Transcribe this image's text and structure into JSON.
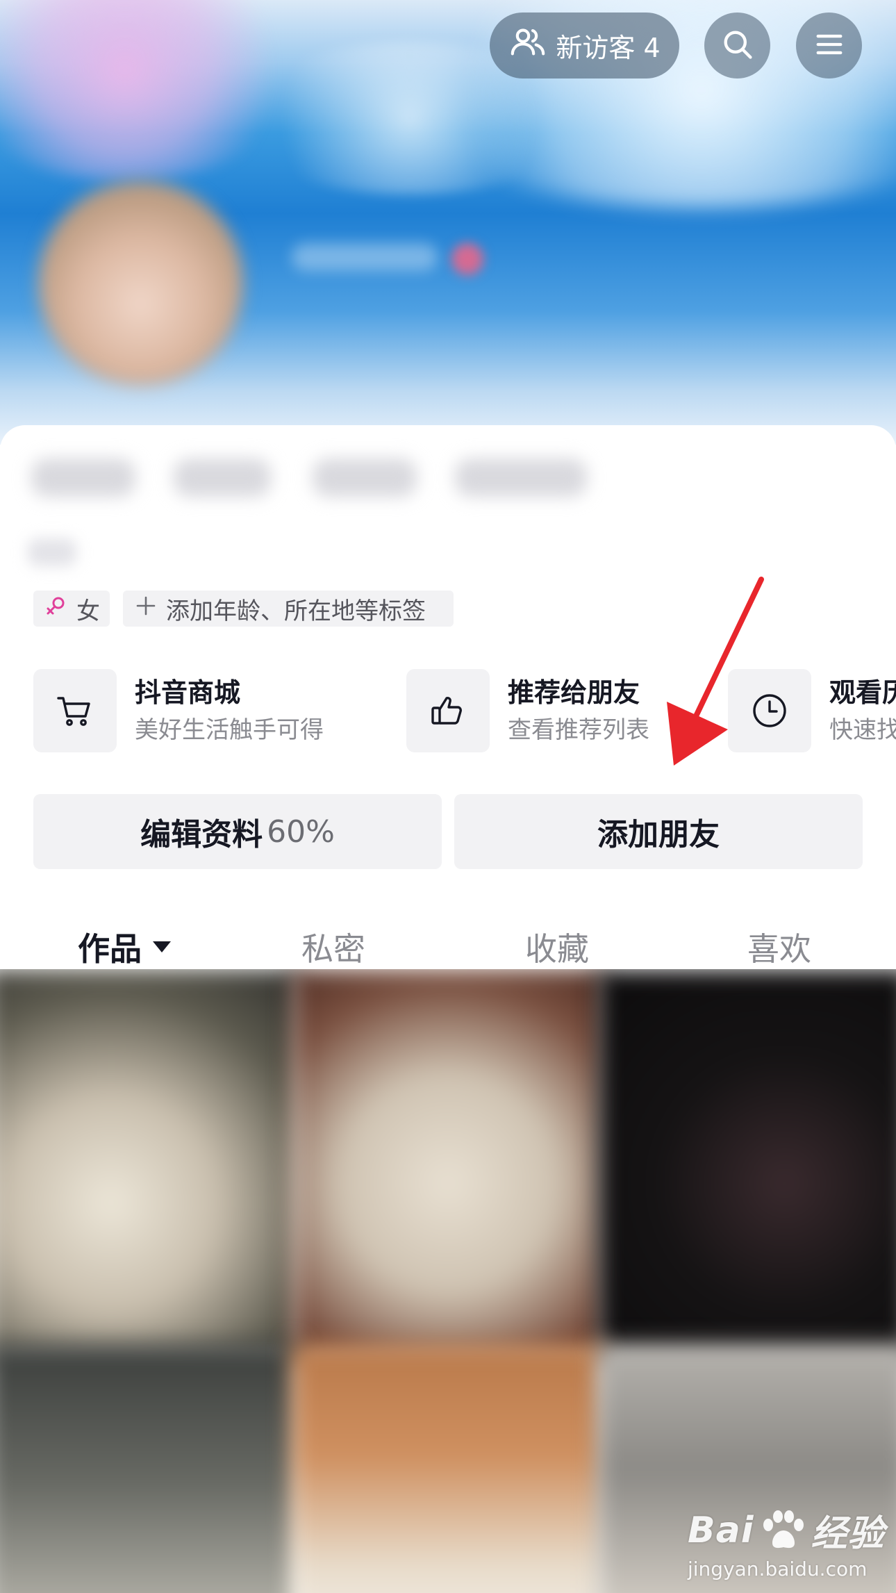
{
  "header": {
    "visitor_label": "新访客 4",
    "icons": [
      "visitors-icon",
      "search-icon",
      "menu-icon"
    ]
  },
  "tags": {
    "gender": "女",
    "add_tags": "添加年龄、所在地等标签"
  },
  "services": [
    {
      "icon": "cart-icon",
      "title": "抖音商城",
      "subtitle": "美好生活触手可得"
    },
    {
      "icon": "thumbs-up-icon",
      "title": "推荐给朋友",
      "subtitle": "查看推荐列表"
    },
    {
      "icon": "clock-icon",
      "title": "观看历史",
      "subtitle": "快速找到"
    }
  ],
  "actions": {
    "edit_profile": "编辑资料",
    "edit_profile_pct": "60%",
    "add_friends": "添加朋友"
  },
  "tabs": [
    {
      "label": "作品",
      "active": true
    },
    {
      "label": "私密",
      "active": false
    },
    {
      "label": "收藏",
      "active": false
    },
    {
      "label": "喜欢",
      "active": false
    }
  ],
  "watermark": {
    "brand_left": "Bai",
    "brand_right": "经验",
    "url": "jingyan.baidu.com"
  },
  "colors": {
    "accent_arrow": "#e8262c",
    "button_bg": "#f2f2f4",
    "text_primary": "#161823",
    "text_secondary": "#8a8b91"
  }
}
